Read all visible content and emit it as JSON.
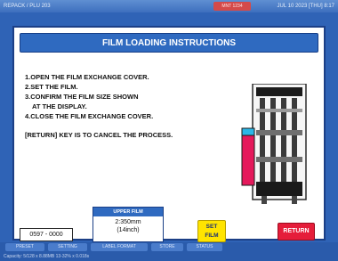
{
  "top_bar": {
    "left": "REPACK / PLU 203",
    "middle": "MNT 1234",
    "right": "JUL 10 2023 [THU] 8:17"
  },
  "dialog": {
    "title": "FILM LOADING INSTRUCTIONS",
    "instructions": [
      "1.OPEN THE FILM EXCHANGE COVER.",
      "2.SET THE FILM.",
      "3.CONFIRM THE FILM SIZE SHOWN",
      "AT THE DISPLAY.",
      "4.CLOSE THE FILM EXCHANGE COVER."
    ],
    "cancel_note": "[RETURN] KEY IS TO CANCEL THE PROCESS."
  },
  "footer_controls": {
    "code": "0597 - 0000",
    "upper_film": {
      "label": "UPPER FILM",
      "size_mm": "2:350mm",
      "size_in": "(14inch)"
    },
    "set_film_label": [
      "SET",
      "FILM"
    ],
    "return_label": "RETURN"
  },
  "bottom_bar": {
    "tabs": [
      "PRESET",
      "SETTING",
      "LABEL FORMAT",
      "STORE",
      "STATUS"
    ],
    "status": "Capacity: 5/128 x 8.88MB  13-32% x 0.018s"
  },
  "colors": {
    "background": "#2f63b6",
    "title_bar": "#2f6ac0",
    "set_film": "#ffe400",
    "return": "#e51d3a",
    "machine_cyan": "#2bb7e8",
    "machine_magenta": "#e4195b"
  },
  "icons": [
    "printer-machine-icon"
  ]
}
